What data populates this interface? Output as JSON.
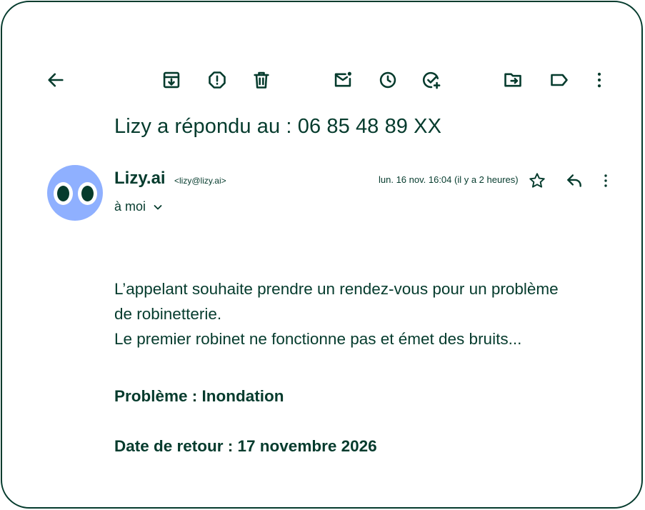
{
  "toolbar": {
    "icons": [
      "arrow-back-icon",
      "archive-icon",
      "report-spam-icon",
      "delete-icon",
      "mark-unread-icon",
      "snooze-icon",
      "add-to-tasks-icon",
      "move-to-icon",
      "label-icon",
      "more-vert-icon"
    ]
  },
  "email": {
    "subject": "Lizy a répondu au : 06 85 48 89 XX",
    "sender_name": "Lizy.ai",
    "sender_email": "<lizy@lizy.ai>",
    "timestamp": "lun. 16 nov. 16:04 (il y a 2 heures)",
    "recipient": "à moi",
    "body_lines": [
      "L’appelant souhaite prendre un rendez-vous pour un problème",
      "de robinetterie.",
      "Le premier robinet ne fonctionne pas et émet des bruits..."
    ],
    "fields": [
      {
        "label": "Problème : ",
        "value": "Inondation"
      },
      {
        "label": "Date de retour : ",
        "value": "17 novembre 2026"
      }
    ]
  },
  "colors": {
    "primary": "#053b2d",
    "avatar_bg": "#8fb0ff",
    "background": "#ffffff"
  }
}
